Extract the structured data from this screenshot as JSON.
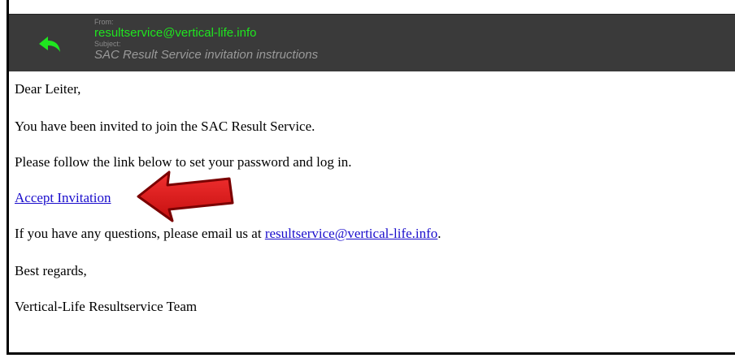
{
  "header": {
    "from_label": "From:",
    "from_value": "resultservice@vertical-life.info",
    "subject_label": "Subject:",
    "subject_value": "SAC Result Service invitation instructions",
    "reply_icon": "reply-arrow-icon",
    "accent_color": "#1fe61f"
  },
  "message": {
    "greeting": "Dear Leiter,",
    "line1": "You have been invited to join the SAC Result Service.",
    "line2": "Please follow the link below to set your password and log in.",
    "link_label": "Accept Invitation",
    "questions_prefix": "If you have any questions, please email us at ",
    "questions_email": "resultservice@vertical-life.info",
    "questions_suffix": ".",
    "closing": "Best regards,",
    "signature": "Vertical-Life Resultservice Team"
  },
  "annotation": {
    "arrow_icon": "red-pointer-arrow",
    "arrow_color": "#e31b1b"
  }
}
